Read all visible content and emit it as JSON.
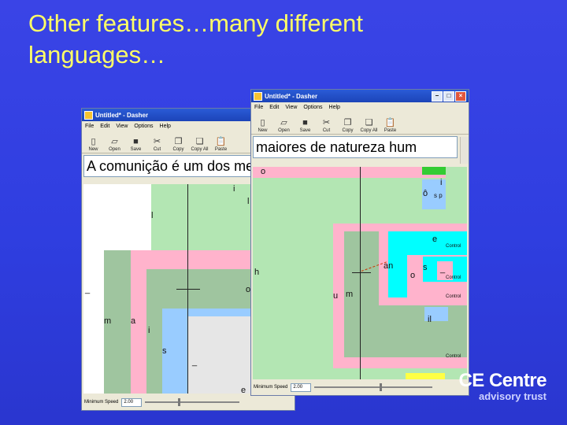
{
  "slide": {
    "title": "Other features…many different languages…"
  },
  "watermark": {
    "main": "CE Centre",
    "sub": "advisory trust"
  },
  "colors": {
    "slide_bg": "#3240e0",
    "title": "#ffff66",
    "green": "#b3e6b3",
    "pink": "#ffb3cc",
    "cyan": "#00ffff",
    "gray_green": "#9fc59f",
    "yellow": "#ffff44"
  },
  "back_window": {
    "title": "Untitled* - Dasher",
    "menu": [
      "File",
      "Edit",
      "View",
      "Options",
      "Help"
    ],
    "toolbar": [
      "New",
      "Open",
      "Save",
      "Cut",
      "Copy",
      "Copy All",
      "Paste"
    ],
    "text": "A comunição é um dos meios",
    "letters": [
      "l",
      "i",
      "l",
      "_",
      "m",
      "a",
      "i",
      "o",
      "s",
      "_",
      "e"
    ],
    "status_label": "Minimum Speed",
    "speed": "2.00",
    "speed_fraction": 0.35
  },
  "front_window": {
    "title": "Untitled* - Dasher",
    "menu": [
      "File",
      "Edit",
      "View",
      "Options",
      "Help"
    ],
    "toolbar": [
      "New",
      "Open",
      "Save",
      "Cut",
      "Copy",
      "Copy All",
      "Paste"
    ],
    "text": "maiores de natureza hum",
    "letters": [
      "o",
      "i",
      "ô",
      "s p",
      "h",
      "e",
      "an",
      "o",
      "s",
      "u",
      "m",
      "il",
      "_"
    ],
    "control_labels": [
      "Control",
      "Control",
      "Control",
      "Control"
    ],
    "status_label": "Minimum Speed",
    "speed": "2.00",
    "speed_fraction": 0.55
  }
}
